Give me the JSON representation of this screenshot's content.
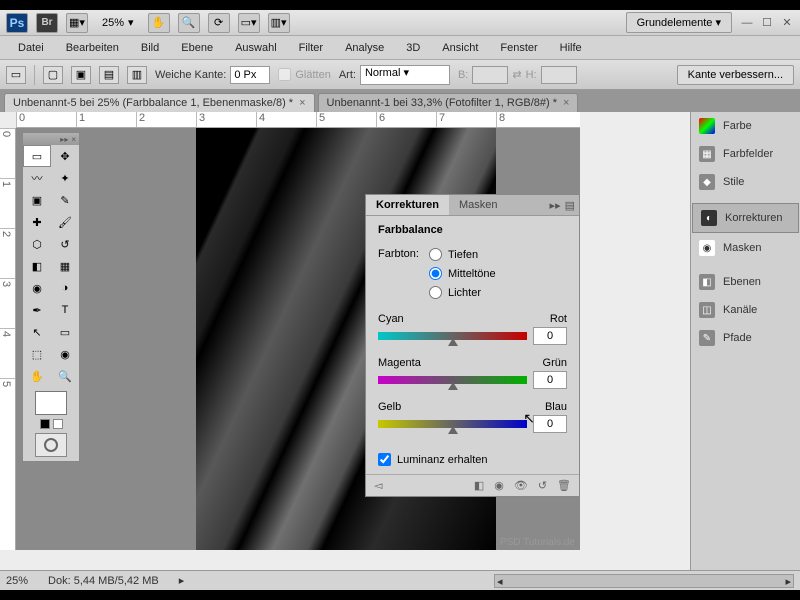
{
  "titlebar": {
    "zoom": "25%",
    "workspace": "Grundelemente"
  },
  "menu": [
    "Datei",
    "Bearbeiten",
    "Bild",
    "Ebene",
    "Auswahl",
    "Filter",
    "Analyse",
    "3D",
    "Ansicht",
    "Fenster",
    "Hilfe"
  ],
  "options": {
    "weiche_kante_label": "Weiche Kante:",
    "weiche_kante_value": "0 Px",
    "glaetten_label": "Glätten",
    "art_label": "Art:",
    "art_value": "Normal",
    "b_label": "B:",
    "h_label": "H:",
    "refine_edge": "Kante verbessern..."
  },
  "tabs": [
    {
      "label": "Unbenannt-5 bei 25% (Farbbalance 1, Ebenenmaske/8) *",
      "active": true
    },
    {
      "label": "Unbenannt-1 bei 33,3% (Fotofilter 1, RGB/8#) *",
      "active": false
    }
  ],
  "ruler_h": [
    "0",
    "1",
    "2",
    "3",
    "4",
    "5",
    "6",
    "7",
    "8"
  ],
  "ruler_v": [
    "0",
    "1",
    "2",
    "3",
    "4",
    "5"
  ],
  "sidepanel": {
    "groups": [
      [
        "Farbe",
        "Farbfelder",
        "Stile"
      ],
      [
        "Korrekturen",
        "Masken"
      ],
      [
        "Ebenen",
        "Kanäle",
        "Pfade"
      ]
    ],
    "selected": "Korrekturen"
  },
  "korr": {
    "tabs": [
      "Korrekturen",
      "Masken"
    ],
    "active_tab": "Korrekturen",
    "title": "Farbbalance",
    "farbton_label": "Farbton:",
    "radios": [
      "Tiefen",
      "Mitteltöne",
      "Lichter"
    ],
    "radio_selected": "Mitteltöne",
    "sliders": [
      {
        "left": "Cyan",
        "right": "Rot",
        "value": "0"
      },
      {
        "left": "Magenta",
        "right": "Grün",
        "value": "0"
      },
      {
        "left": "Gelb",
        "right": "Blau",
        "value": "0"
      }
    ],
    "luminance_label": "Luminanz erhalten",
    "luminance_checked": true
  },
  "status": {
    "zoom": "25%",
    "doc": "Dok: 5,44 MB/5,42 MB"
  },
  "watermark": "PSD Tutorials.de"
}
